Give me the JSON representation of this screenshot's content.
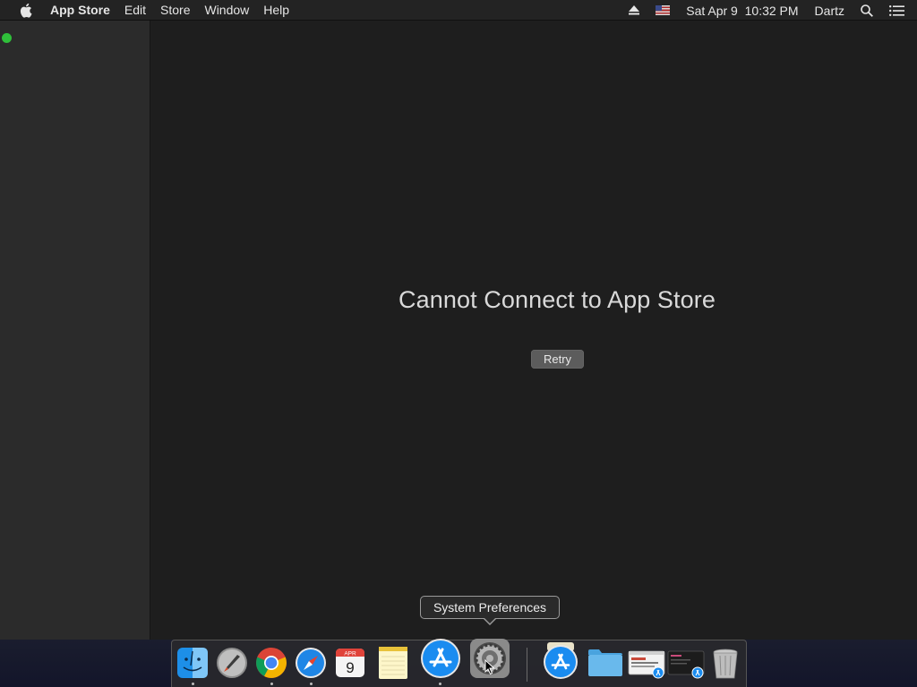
{
  "menubar": {
    "app_name": "App Store",
    "menus": [
      "Edit",
      "Store",
      "Window",
      "Help"
    ],
    "datetime": "Sat Apr 9  10:32 PM",
    "user": "Dartz",
    "icons": [
      "apple-icon",
      "eject-icon",
      "us-flag-input-icon",
      "spotlight-search-icon",
      "notification-center-icon"
    ]
  },
  "main": {
    "error_title": "Cannot Connect to App Store",
    "retry_label": "Retry"
  },
  "tooltip": {
    "text": "System Preferences"
  },
  "dock": {
    "items": [
      {
        "name": "finder-icon",
        "running": true
      },
      {
        "name": "launchpad-icon",
        "running": false
      },
      {
        "name": "chrome-icon",
        "running": true
      },
      {
        "name": "safari-icon",
        "running": true
      },
      {
        "name": "calendar-icon",
        "running": false,
        "month": "APR",
        "day": "9"
      },
      {
        "name": "notes-icon",
        "running": false
      },
      {
        "name": "app-store-icon",
        "running": true
      },
      {
        "name": "system-preferences-icon",
        "running": false
      },
      {
        "name": "app-store-download-icon",
        "running": false
      },
      {
        "name": "folder-icon",
        "running": false
      },
      {
        "name": "browser-window-icon",
        "running": false
      },
      {
        "name": "dark-window-icon",
        "running": false
      },
      {
        "name": "trash-icon",
        "running": false
      }
    ]
  },
  "colors": {
    "accent_green": "#2fbf3a",
    "appstore_blue": "#1a8cf0"
  }
}
